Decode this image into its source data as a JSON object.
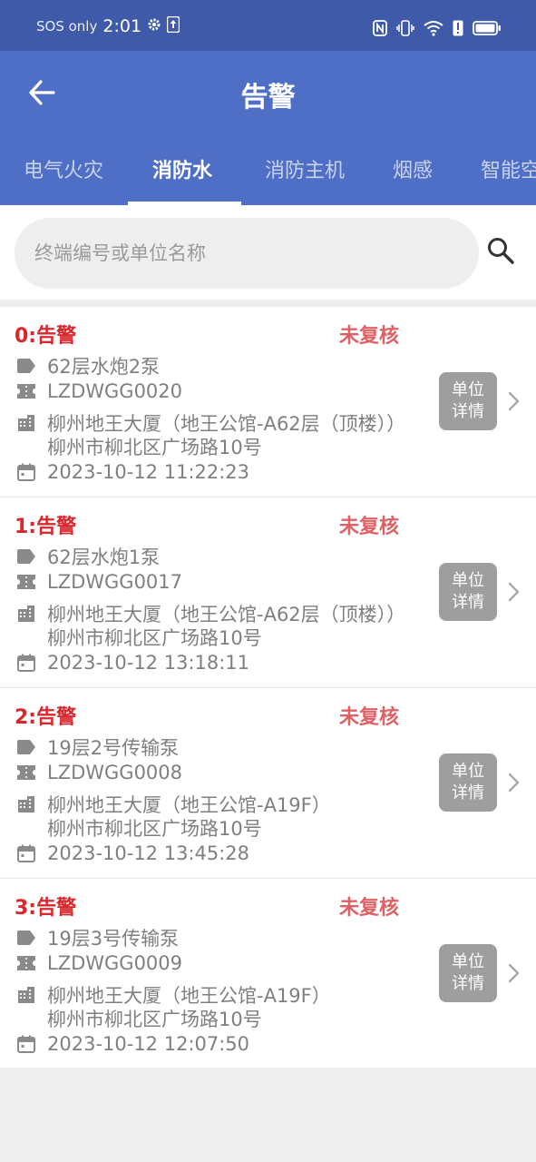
{
  "status_bar": {
    "sos_text": "SOS only",
    "time": "2:01",
    "icons": [
      "settings-icon",
      "upload-icon",
      "nfc-icon",
      "vibrate-icon",
      "wifi-icon",
      "alert-icon",
      "battery-icon"
    ]
  },
  "app_bar": {
    "title": "告警",
    "back_icon": "arrow-left-icon"
  },
  "tabs": [
    {
      "label": "电气火灾",
      "active": false
    },
    {
      "label": "消防水",
      "active": true
    },
    {
      "label": "消防主机",
      "active": false
    },
    {
      "label": "烟感",
      "active": false
    },
    {
      "label": "智能空",
      "active": false
    }
  ],
  "search": {
    "placeholder": "终端编号或单位名称",
    "value": ""
  },
  "alarms": [
    {
      "title": "0:告警",
      "status": "未复核",
      "name": "62层水炮2泵",
      "code": "LZDWGG0020",
      "address_line1": "柳州地王大厦（地王公馆-A62层（顶楼））",
      "address_line2": "柳州市柳北区广场路10号",
      "time": "2023-10-12 11:22:23",
      "detail_label_line1": "单位",
      "detail_label_line2": "详情"
    },
    {
      "title": "1:告警",
      "status": "未复核",
      "name": "62层水炮1泵",
      "code": "LZDWGG0017",
      "address_line1": "柳州地王大厦（地王公馆-A62层（顶楼））",
      "address_line2": "柳州市柳北区广场路10号",
      "time": "2023-10-12 13:18:11",
      "detail_label_line1": "单位",
      "detail_label_line2": "详情"
    },
    {
      "title": "2:告警",
      "status": "未复核",
      "name": "19层2号传输泵",
      "code": "LZDWGG0008",
      "address_line1": "柳州地王大厦（地王公馆-A19F）",
      "address_line2": "柳州市柳北区广场路10号",
      "time": "2023-10-12 13:45:28",
      "detail_label_line1": "单位",
      "detail_label_line2": "详情"
    },
    {
      "title": "3:告警",
      "status": "未复核",
      "name": "19层3号传输泵",
      "code": "LZDWGG0009",
      "address_line1": "柳州地王大厦（地王公馆-A19F）",
      "address_line2": "柳州市柳北区广场路10号",
      "time": "2023-10-12 12:07:50",
      "detail_label_line1": "单位",
      "detail_label_line2": "详情"
    }
  ],
  "colors": {
    "status_bar": "#3e5aa8",
    "app_bar": "#4f6ec5",
    "alarm_title": "#d9282d",
    "alarm_status": "#e06165",
    "detail_button": "#9e9e9e"
  }
}
